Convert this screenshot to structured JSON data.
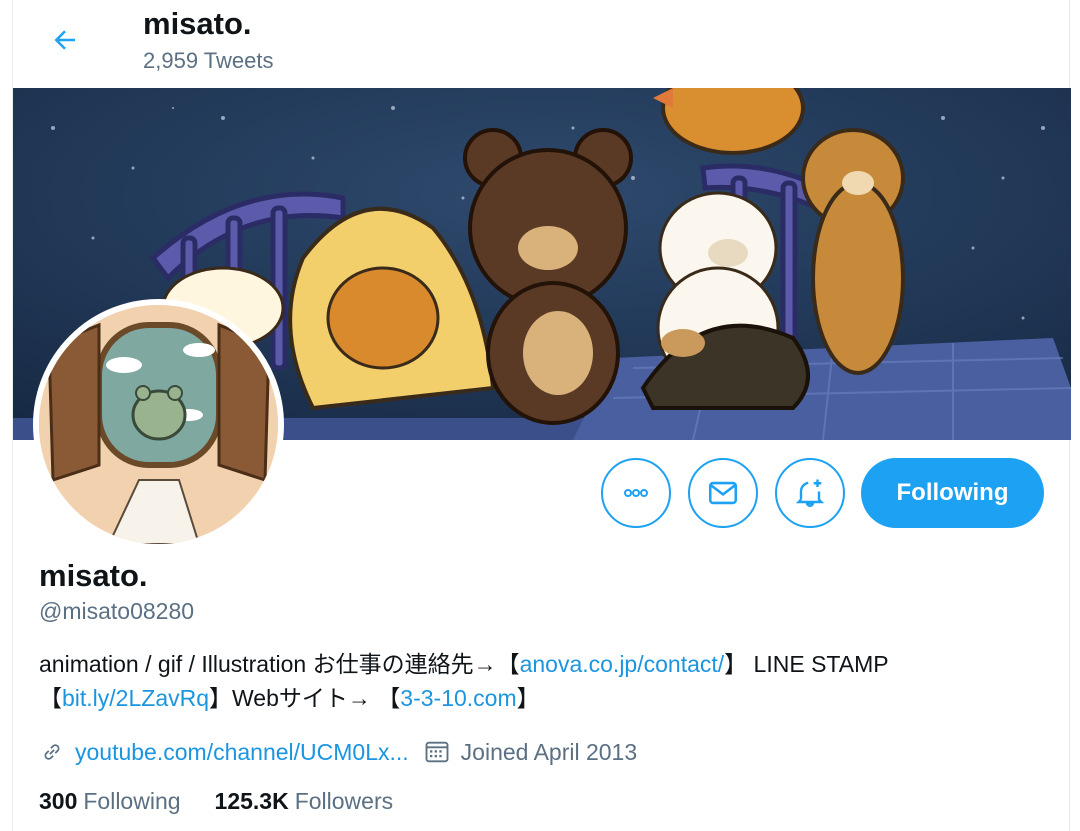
{
  "header": {
    "title": "misato.",
    "tweet_count": "2,959 Tweets"
  },
  "profile": {
    "display_name": "misato.",
    "handle": "@misato08280",
    "bio": {
      "seg1": "animation / gif / Illustration お仕事の連絡先→【",
      "link1": "anova.co.jp/contact/",
      "seg2": "】 LINE STAMP 【",
      "link2": "bit.ly/2LZavRq",
      "seg3": "】Webサイト→ 【",
      "link3": "3-3-10.com",
      "seg4": "】"
    },
    "website": "youtube.com/channel/UCM0Lx...",
    "joined": "Joined April 2013",
    "following_count": "300",
    "following_label": "Following",
    "followers_count": "125.3K",
    "followers_label": "Followers"
  },
  "actions": {
    "follow_label": "Following"
  },
  "icons": {
    "back": "back-arrow-icon",
    "more": "more-icon",
    "message": "mail-icon",
    "notify": "bell-plus-icon",
    "link": "link-icon",
    "calendar": "calendar-icon"
  },
  "colors": {
    "accent": "#1da1f2",
    "link": "#1b95e0",
    "muted": "#5b7083",
    "text": "#0f1419"
  }
}
